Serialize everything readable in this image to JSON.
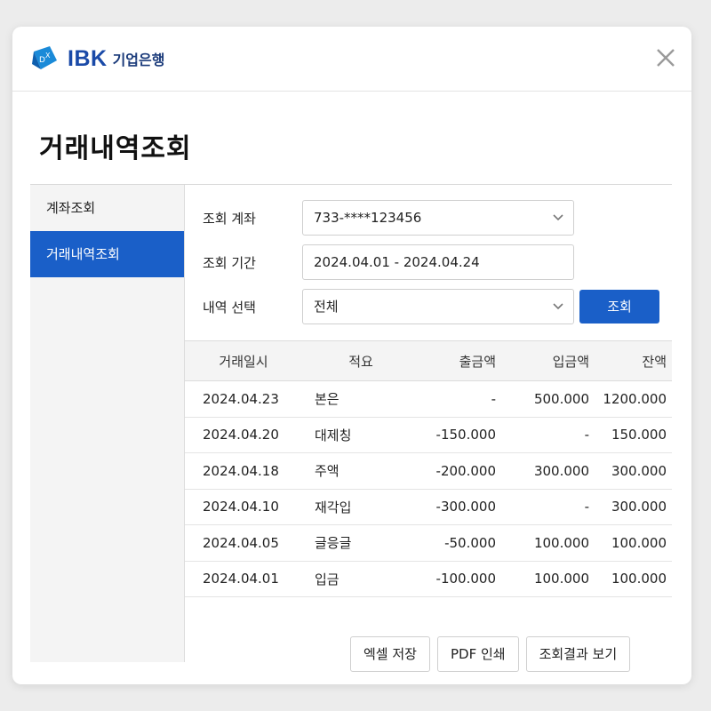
{
  "brand": {
    "ibk": "IBK",
    "name": "기업은행"
  },
  "page_title": "거래내역조회",
  "sidebar": {
    "items": [
      {
        "label": "계좌조회",
        "active": false
      },
      {
        "label": "거래내역조회",
        "active": true
      }
    ]
  },
  "form": {
    "account": {
      "label": "조회 계좌",
      "value": "733-****123456"
    },
    "period": {
      "label": "조회 기간",
      "value": "2024.04.01 - 2024.04.24"
    },
    "type": {
      "label": "내역 선택",
      "value": "전체"
    },
    "search_label": "조회"
  },
  "table": {
    "headers": [
      "거래일시",
      "적요",
      "출금액",
      "입금액",
      "잔액"
    ],
    "rows": [
      [
        "2024.04.23",
        "본은",
        "-",
        "500.000",
        "1200.000"
      ],
      [
        "2024.04.20",
        "대제칭",
        "-150.000",
        "-",
        "150.000"
      ],
      [
        "2024.04.18",
        "주액",
        "-200.000",
        "300.000",
        "300.000"
      ],
      [
        "2024.04.10",
        "재각입",
        "-300.000",
        "-",
        "300.000"
      ],
      [
        "2024.04.05",
        "글응글",
        "-50.000",
        "100.000",
        "100.000"
      ],
      [
        "2024.04.01",
        "입금",
        "-100.000",
        "100.000",
        "100.000"
      ]
    ]
  },
  "buttons": {
    "excel": "엑셀 저장",
    "pdf": "PDF 인쇄",
    "view": "조회결과 보기"
  },
  "colors": {
    "primary": "#1a5fc8",
    "brand": "#1a4aa8"
  }
}
